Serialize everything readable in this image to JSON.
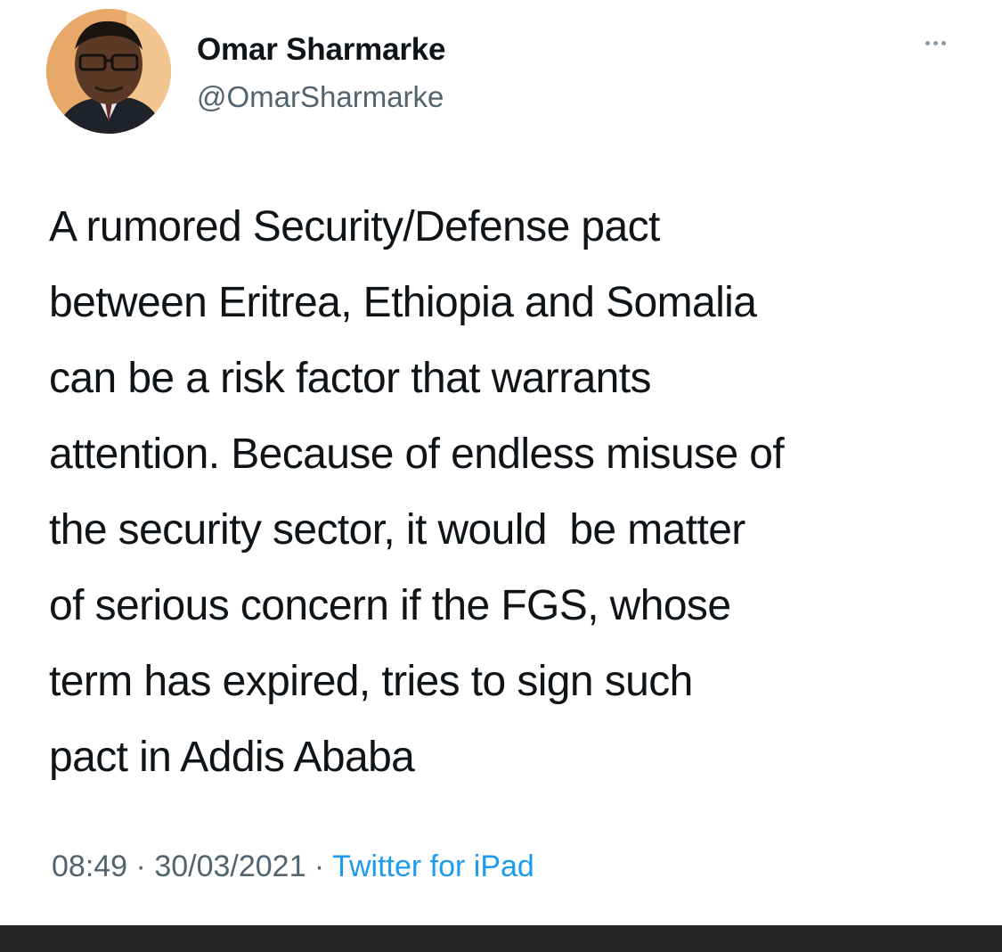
{
  "author": {
    "name": "Omar Sharmarke",
    "handle": "@OmarSharmarke"
  },
  "more_icon": "more-horizontal-icon",
  "tweet": {
    "lines": [
      "A rumored Security/Defense pact",
      "between Eritrea, Ethiopia and Somalia",
      "can be a risk factor that warrants",
      "attention. Because of endless misuse of",
      "the security sector, it would  be matter",
      "of serious concern if the FGS, whose",
      "term has expired, tries to sign such",
      "pact in Addis Ababa"
    ]
  },
  "meta": {
    "time": "08:49",
    "separator": " · ",
    "date": "30/03/2021",
    "source": "Twitter for iPad"
  },
  "colors": {
    "text": "#0f1419",
    "secondary": "#536471",
    "link": "#1d9bf0",
    "bottom_bar": "#242526"
  }
}
